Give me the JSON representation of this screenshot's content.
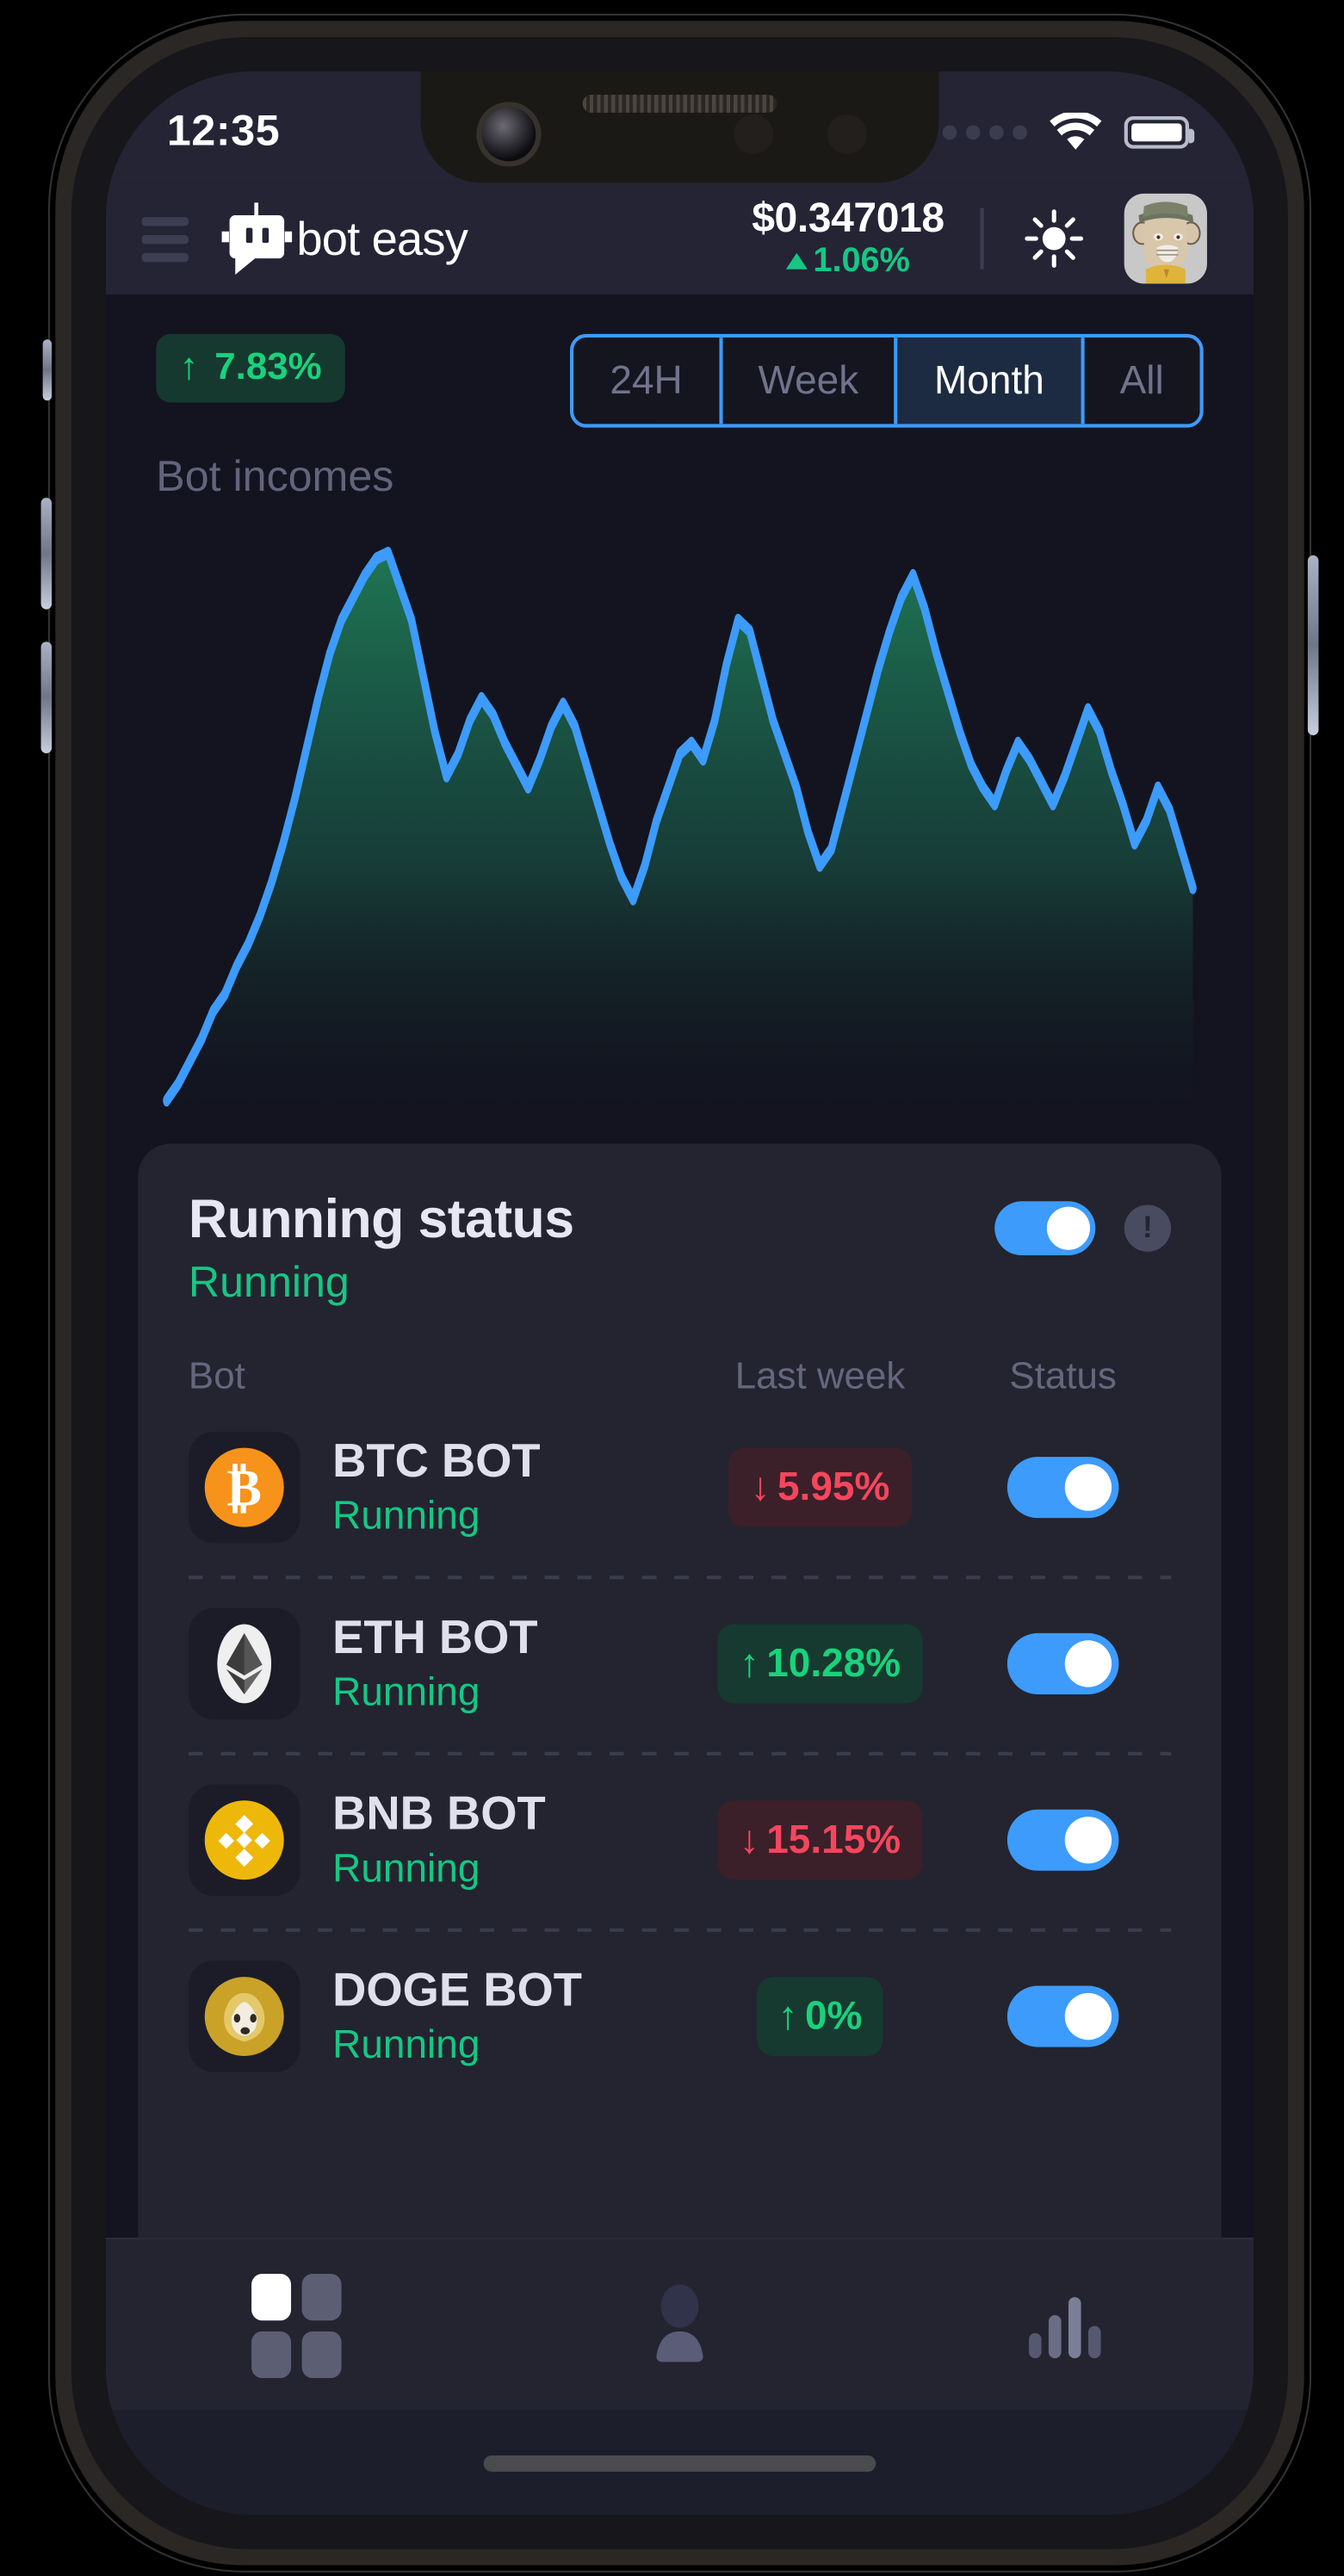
{
  "status_bar": {
    "time": "12:35",
    "signal_icon": "signal-dots-icon",
    "wifi_icon": "wifi-icon",
    "battery_icon": "battery-icon"
  },
  "header": {
    "menu_icon": "hamburger-menu-icon",
    "logo_icon": "bot-logo-icon",
    "brand": "bot easy",
    "price": "$0.347018",
    "price_change": "1.06%",
    "price_change_direction": "up",
    "theme_icon": "sun-icon",
    "avatar_icon": "user-avatar-ape"
  },
  "chart_section": {
    "income_badge": "7.83%",
    "income_badge_arrow": "↑",
    "label": "Bot incomes",
    "tabs": [
      {
        "label": "24H",
        "active": false
      },
      {
        "label": "Week",
        "active": false
      },
      {
        "label": "Month",
        "active": true
      },
      {
        "label": "All",
        "active": false
      }
    ]
  },
  "chart_data": {
    "type": "area",
    "title": "Bot incomes",
    "xlabel": "",
    "ylabel": "",
    "grid": false,
    "legend": "none",
    "line_color": "#3d9bfb",
    "fill_gradient": [
      "#1d6b4f",
      "#13141f"
    ],
    "ylim": [
      0,
      100
    ],
    "x": [
      0,
      1,
      2,
      3,
      4,
      5,
      6,
      7,
      8,
      9,
      10,
      11,
      12,
      13,
      14,
      15,
      16,
      17,
      18,
      19,
      20,
      21,
      22,
      23,
      24,
      25,
      26,
      27,
      28,
      29,
      30,
      31,
      32,
      33,
      34,
      35,
      36,
      37,
      38,
      39,
      40,
      41,
      42,
      43,
      44,
      45,
      46,
      47,
      48,
      49,
      50,
      51,
      52,
      53,
      54,
      55,
      56,
      57,
      58,
      59,
      60,
      61,
      62,
      63,
      64,
      65,
      66,
      67,
      68,
      69,
      70,
      71,
      72,
      73,
      74,
      75,
      76,
      77,
      78,
      79,
      80,
      81,
      82,
      83,
      84,
      85,
      86,
      87,
      88
    ],
    "values": [
      2,
      5,
      9,
      13,
      18,
      21,
      26,
      30,
      35,
      41,
      48,
      56,
      65,
      74,
      82,
      88,
      92,
      96,
      99,
      100,
      94,
      88,
      78,
      68,
      60,
      64,
      70,
      74,
      71,
      66,
      62,
      58,
      63,
      69,
      73,
      69,
      62,
      55,
      48,
      42,
      38,
      44,
      52,
      58,
      64,
      66,
      63,
      70,
      80,
      88,
      86,
      78,
      70,
      64,
      58,
      50,
      44,
      47,
      55,
      63,
      71,
      79,
      86,
      92,
      96,
      90,
      82,
      75,
      68,
      62,
      58,
      55,
      61,
      66,
      63,
      59,
      55,
      60,
      66,
      72,
      68,
      61,
      55,
      48,
      52,
      58,
      54,
      47,
      40
    ]
  },
  "running_card": {
    "title": "Running status",
    "subtitle": "Running",
    "toggle_on": true,
    "info_icon": "info-exclamation-icon",
    "columns": {
      "bot": "Bot",
      "last_week": "Last week",
      "status": "Status"
    },
    "bots": [
      {
        "name": "BTC BOT",
        "status": "Running",
        "icon": "bitcoin-icon",
        "icon_color": "#f7931a",
        "symbol": "Ƀ",
        "change": "5.95%",
        "direction": "down",
        "arrow": "↓",
        "toggle_on": true
      },
      {
        "name": "ETH BOT",
        "status": "Running",
        "icon": "ethereum-icon",
        "icon_color": "#ececec",
        "symbol": "Ξ",
        "change": "10.28%",
        "direction": "up",
        "arrow": "↑",
        "toggle_on": true
      },
      {
        "name": "BNB BOT",
        "status": "Running",
        "icon": "binance-icon",
        "icon_color": "#f0b90b",
        "symbol": "◇",
        "change": "15.15%",
        "direction": "down",
        "arrow": "↓",
        "toggle_on": true
      },
      {
        "name": "DOGE BOT",
        "status": "Running",
        "icon": "dogecoin-icon",
        "icon_color": "#c3a634",
        "symbol": "Ð",
        "change": "0%",
        "direction": "up",
        "arrow": "↑",
        "toggle_on": true
      }
    ]
  },
  "bottom_nav": [
    {
      "icon": "grid-dashboard-icon",
      "active": true
    },
    {
      "icon": "person-profile-icon",
      "active": false
    },
    {
      "icon": "bar-chart-stats-icon",
      "active": false
    }
  ]
}
